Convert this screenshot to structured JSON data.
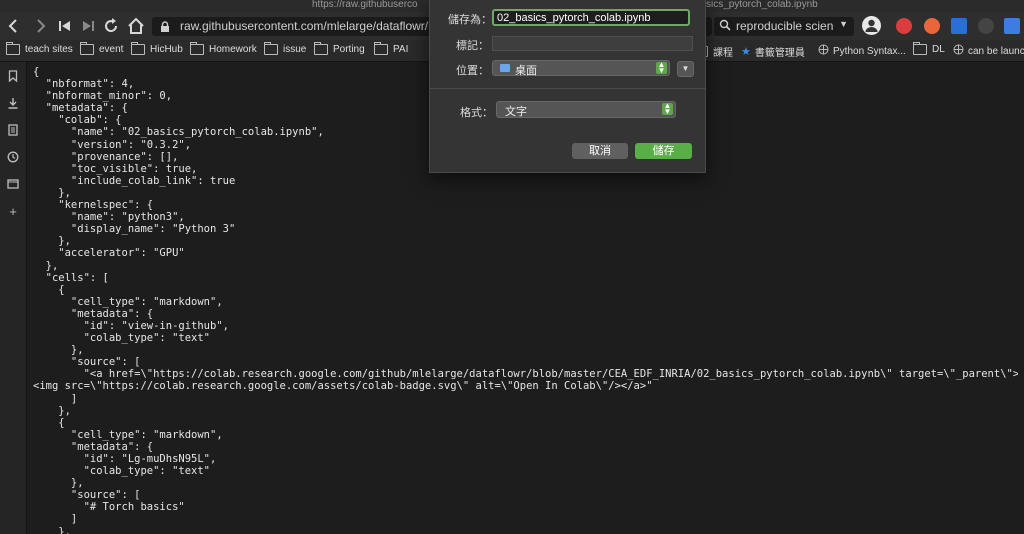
{
  "window": {
    "title_left": "https://raw.githubuserco",
    "title_right": "sics_pytorch_colab.ipynb"
  },
  "toolbar": {
    "url": "raw.githubusercontent.com/mlelarge/dataflowr/master",
    "search_text": "reproducible scien"
  },
  "bookmarks": [
    {
      "label": "teach sites",
      "icon": "folder-icon"
    },
    {
      "label": "event",
      "icon": "folder-icon"
    },
    {
      "label": "HicHub",
      "icon": "folder-icon"
    },
    {
      "label": "Homework",
      "icon": "folder-icon"
    },
    {
      "label": "issue",
      "icon": "folder-icon"
    },
    {
      "label": "Porting",
      "icon": "folder-icon"
    },
    {
      "label": "PAI",
      "icon": "folder-icon"
    },
    {
      "label": "課程",
      "icon": "folder-icon"
    },
    {
      "label": "書籤管理員",
      "icon": "star-icon"
    },
    {
      "label": "Python Syntax...",
      "icon": "globe-icon"
    },
    {
      "label": "DL",
      "icon": "folder-icon"
    },
    {
      "label": "can be launc",
      "icon": "globe-icon"
    }
  ],
  "dialog": {
    "save_as_label": "儲存為：",
    "save_as_value": "02_basics_pytorch_colab.ipynb",
    "tags_label": "標記：",
    "location_label": "位置：",
    "location_value": "桌面",
    "format_label": "格式：",
    "format_value": "文字",
    "cancel_label": "取消",
    "save_label": "儲存"
  },
  "code_lines": [
    "{",
    "  \"nbformat\": 4,",
    "  \"nbformat_minor\": 0,",
    "  \"metadata\": {",
    "    \"colab\": {",
    "      \"name\": \"02_basics_pytorch_colab.ipynb\",",
    "      \"version\": \"0.3.2\",",
    "      \"provenance\": [],",
    "      \"toc_visible\": true,",
    "      \"include_colab_link\": true",
    "    },",
    "    \"kernelspec\": {",
    "      \"name\": \"python3\",",
    "      \"display_name\": \"Python 3\"",
    "    },",
    "    \"accelerator\": \"GPU\"",
    "  },",
    "  \"cells\": [",
    "    {",
    "      \"cell_type\": \"markdown\",",
    "      \"metadata\": {",
    "        \"id\": \"view-in-github\",",
    "        \"colab_type\": \"text\"",
    "      },",
    "      \"source\": [",
    "        \"<a href=\\\"https://colab.research.google.com/github/mlelarge/dataflowr/blob/master/CEA_EDF_INRIA/02_basics_pytorch_colab.ipynb\\\" target=\\\"_parent\\\">",
    "<img src=\\\"https://colab.research.google.com/assets/colab-badge.svg\\\" alt=\\\"Open In Colab\\\"/></a>\"",
    "      ]",
    "    },",
    "    {",
    "      \"cell_type\": \"markdown\",",
    "      \"metadata\": {",
    "        \"id\": \"Lg-muDhsN95L\",",
    "        \"colab_type\": \"text\"",
    "      },",
    "      \"source\": [",
    "        \"# Torch basics\"",
    "      ]",
    "    },"
  ]
}
